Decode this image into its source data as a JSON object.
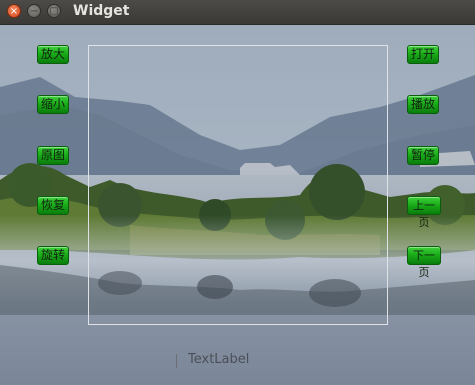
{
  "window": {
    "title": "Widget"
  },
  "left_buttons": [
    {
      "label": "放大"
    },
    {
      "label": "缩小"
    },
    {
      "label": "原图"
    },
    {
      "label": "恢复"
    },
    {
      "label": "旋转"
    }
  ],
  "right_buttons": [
    {
      "label": "打开"
    },
    {
      "label": "播放"
    },
    {
      "label": "暂停"
    },
    {
      "label": "上一页"
    },
    {
      "label": "下一页"
    }
  ],
  "text_label": "TextLabel",
  "colors": {
    "button_green": "#18a817",
    "frame_border": "#dfe3e8",
    "titlebar": "#3f3e3a"
  }
}
